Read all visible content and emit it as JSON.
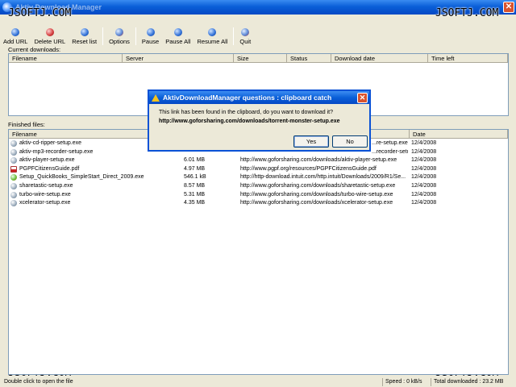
{
  "window": {
    "title": "Aktiv Download Manager",
    "close_glyph": "✕"
  },
  "watermark": "JSOFTJ.COM",
  "toolbar": [
    {
      "label": "Add URL",
      "icon": "add-icon"
    },
    {
      "label": "Delete URL",
      "icon": "delete-icon"
    },
    {
      "label": "Reset list",
      "icon": "reset-icon"
    },
    {
      "label": "Options",
      "icon": "options-icon"
    },
    {
      "label": "Pause",
      "icon": "pause-icon"
    },
    {
      "label": "Pause All",
      "icon": "pause-all-icon"
    },
    {
      "label": "Resume All",
      "icon": "resume-all-icon"
    },
    {
      "label": "Quit",
      "icon": "quit-icon"
    }
  ],
  "current": {
    "label": "Current downloads:",
    "columns": [
      "Filename",
      "Server",
      "Size",
      "Status",
      "Download date",
      "Time left"
    ]
  },
  "finished": {
    "label": "Finished files:",
    "columns": [
      "Filename",
      "",
      "",
      "Date"
    ],
    "rows": [
      {
        "name": "aktiv-cd-ripper-setup.exe",
        "size": "",
        "url": "http://www.goforsharing.com/downloads/aktiv-cd-ripper-setup.exe",
        "url_visible": "...re-setup.exe",
        "date": "12/4/2008",
        "icon": "exe-icon"
      },
      {
        "name": "aktiv-mp3-recorder-setup.exe",
        "size": "",
        "url": "",
        "url_visible": "...recorder-setup...",
        "date": "12/4/2008",
        "icon": "exe-icon"
      },
      {
        "name": "aktiv-player-setup.exe",
        "size": "6.01 MB",
        "url": "http://www.goforsharing.com/downloads/aktiv-player-setup.exe",
        "date": "12/4/2008",
        "icon": "exe-icon"
      },
      {
        "name": "PGPFCitizensGuide.pdf",
        "size": "4.97 MB",
        "url": "http://www.pgpf.org/resources/PGPFCitizensGuide.pdf",
        "date": "12/4/2008",
        "icon": "pdf-icon"
      },
      {
        "name": "Setup_QuickBooks_SimpleStart_Direct_2009.exe",
        "size": "546.1 kB",
        "url": "http://http-download.intuit.com/http.intuit/Downloads/2009/R1/Se...",
        "date": "12/4/2008",
        "icon": "setup-icon"
      },
      {
        "name": "sharetastic-setup.exe",
        "size": "8.57 MB",
        "url": "http://www.goforsharing.com/downloads/sharetastic-setup.exe",
        "date": "12/4/2008",
        "icon": "exe-icon"
      },
      {
        "name": "turbo-wire-setup.exe",
        "size": "5.31 MB",
        "url": "http://www.goforsharing.com/downloads/turbo-wire-setup.exe",
        "date": "12/4/2008",
        "icon": "exe-icon"
      },
      {
        "name": "xcelerator-setup.exe",
        "size": "4.35 MB",
        "url": "http://www.goforsharing.com/downloads/xcelerator-setup.exe",
        "date": "12/4/2008",
        "icon": "exe-icon"
      }
    ]
  },
  "dialog": {
    "title": "AktivDownloadManager questions : clipboard catch",
    "message": "This link has been found in the clipboard, do you want to download it?",
    "url": "http://www.goforsharing.com/downloads/torrent-monster-setup.exe",
    "yes_label": "Yes",
    "no_label": "No",
    "close_glyph": "✕"
  },
  "status": {
    "hint": "Double click to open the file",
    "speed": "Speed : 0 kB/s",
    "total": "Total downloaded : 23.2 MB"
  }
}
